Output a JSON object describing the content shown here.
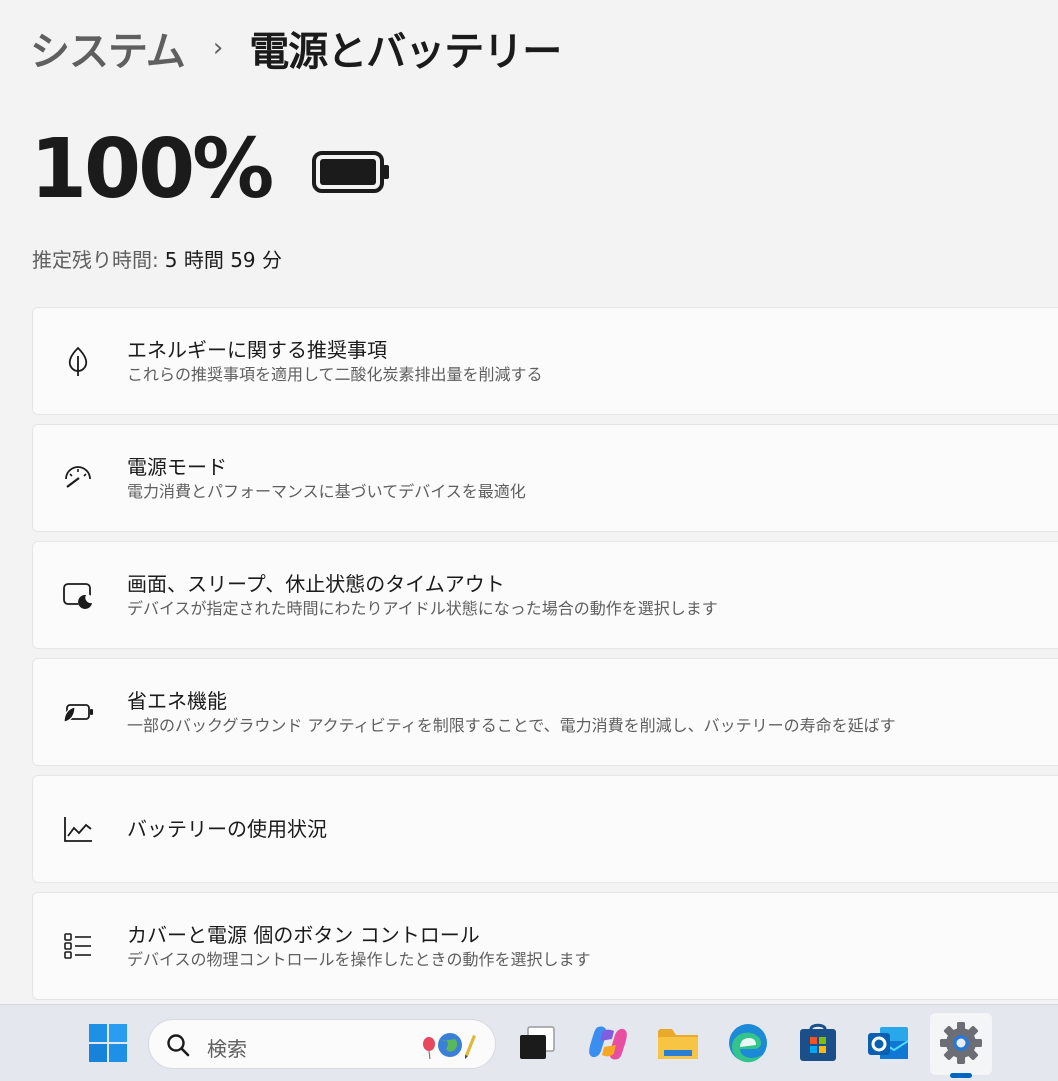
{
  "breadcrumb": {
    "parent": "システム",
    "separator": "›",
    "current": "電源とバッテリー"
  },
  "battery": {
    "percent_text": "100%",
    "level": 1.0,
    "estimate_label": "推定残り時間:",
    "estimate_value": "5 時間 59 分"
  },
  "cards": [
    {
      "icon": "leaf-icon",
      "title": "エネルギーに関する推奨事項",
      "desc": "これらの推奨事項を適用して二酸化炭素排出量を削減する"
    },
    {
      "icon": "speedometer-icon",
      "title": "電源モード",
      "desc": "電力消費とパフォーマンスに基づいてデバイスを最適化"
    },
    {
      "icon": "screen-sleep-icon",
      "title": "画面、スリープ、休止状態のタイムアウト",
      "desc": "デバイスが指定された時間にわたりアイドル状態になった場合の動作を選択します"
    },
    {
      "icon": "battery-saver-icon",
      "title": "省エネ機能",
      "desc": "一部のバックグラウンド アクティビティを制限することで、電力消費を削減し、バッテリーの寿命を延ばす"
    },
    {
      "icon": "chart-line-icon",
      "title": "バッテリーの使用状況",
      "desc": ""
    },
    {
      "icon": "list-icon",
      "title": "カバーと電源 個のボタン コントロール",
      "desc": "デバイスの物理コントロールを操作したときの動作を選択します"
    }
  ],
  "taskbar": {
    "search_placeholder": "検索",
    "apps": [
      "windows-start-icon",
      "task-view-icon",
      "copilot-icon",
      "file-explorer-icon",
      "edge-icon",
      "store-icon",
      "outlook-icon",
      "settings-icon"
    ],
    "active_app": "settings-icon",
    "accent_color": "#0067c0"
  }
}
